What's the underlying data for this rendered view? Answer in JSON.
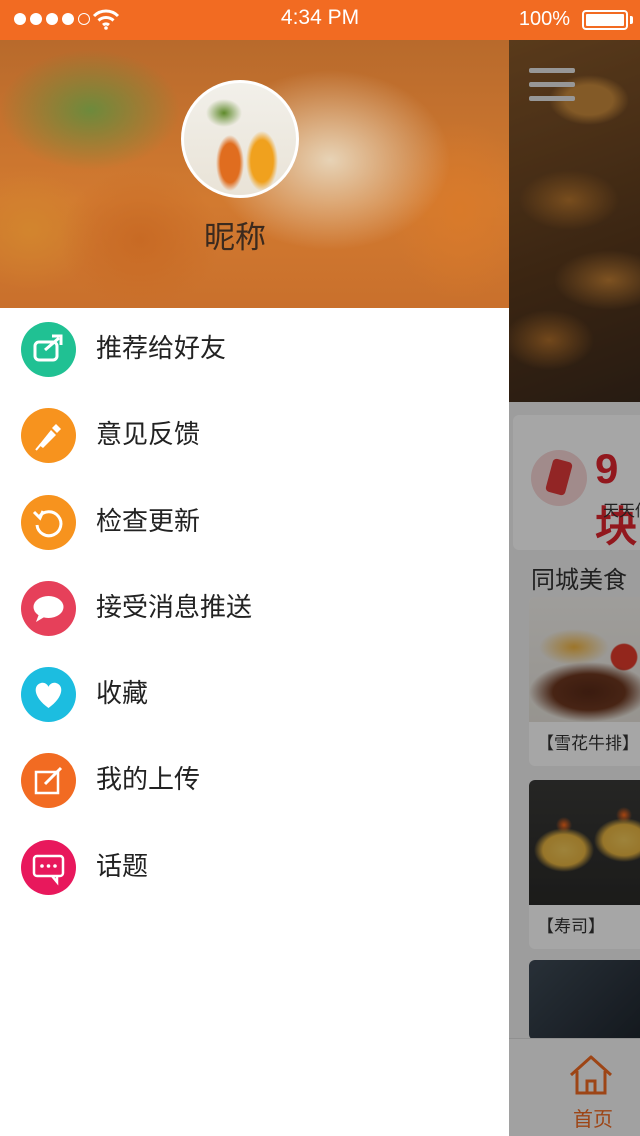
{
  "status_bar": {
    "time": "4:34 PM",
    "battery_pct": "100%",
    "signal_bars_filled": 4,
    "signal_bars_total": 5
  },
  "drawer": {
    "nickname": "昵称",
    "menu": [
      {
        "label": "推荐给好友",
        "icon": "share-icon",
        "color": "#20c193"
      },
      {
        "label": "意见反馈",
        "icon": "pen-icon",
        "color": "#f7931e"
      },
      {
        "label": "检查更新",
        "icon": "refresh-icon",
        "color": "#f7931e"
      },
      {
        "label": "接受消息推送",
        "icon": "chat-bubble-icon",
        "color": "#e6405a"
      },
      {
        "label": "收藏",
        "icon": "heart-icon",
        "color": "#1cbde0"
      },
      {
        "label": "我的上传",
        "icon": "edit-icon",
        "color": "#f26b22"
      },
      {
        "label": "话题",
        "icon": "message-icon",
        "color": "#e8185c"
      }
    ]
  },
  "main": {
    "promo_value": "9块",
    "promo_sub": "天天低",
    "section_title": "同城美食",
    "cards": [
      {
        "caption": "【雪花牛排】"
      },
      {
        "caption": "【寿司】"
      }
    ],
    "tab_home_label": "首页"
  },
  "colors": {
    "accent": "#f26b22",
    "promo_red": "#e0262f"
  }
}
